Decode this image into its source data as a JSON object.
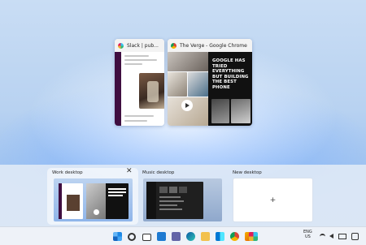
{
  "windows": [
    {
      "title": "Slack | pub...",
      "app": "Slack"
    },
    {
      "title": "The Verge - Google Chrome",
      "app": "Chrome",
      "headline": "GOOGLE HAS TRIED EVERYTHING BUT BUILDING THE BEST PHONE"
    }
  ],
  "desktops": [
    {
      "label": "Work desktop",
      "active": true
    },
    {
      "label": "Music desktop",
      "active": false
    }
  ],
  "new_desktop": {
    "label": "New desktop",
    "plus": "+"
  },
  "close_glyph": "✕",
  "taskbar": {
    "icons": [
      "windows-start-icon",
      "search-icon",
      "task-view-icon",
      "widgets-icon",
      "teams-chat-icon",
      "edge-icon",
      "file-explorer-icon",
      "store-icon",
      "chrome-icon",
      "snipping-icon",
      "slack-icon"
    ],
    "tray": {
      "lang": "ENG",
      "region": "US"
    }
  },
  "colors": {
    "accent": "#0a5fd8",
    "slack": "#3f0e40",
    "verge_bg": "#111111"
  }
}
